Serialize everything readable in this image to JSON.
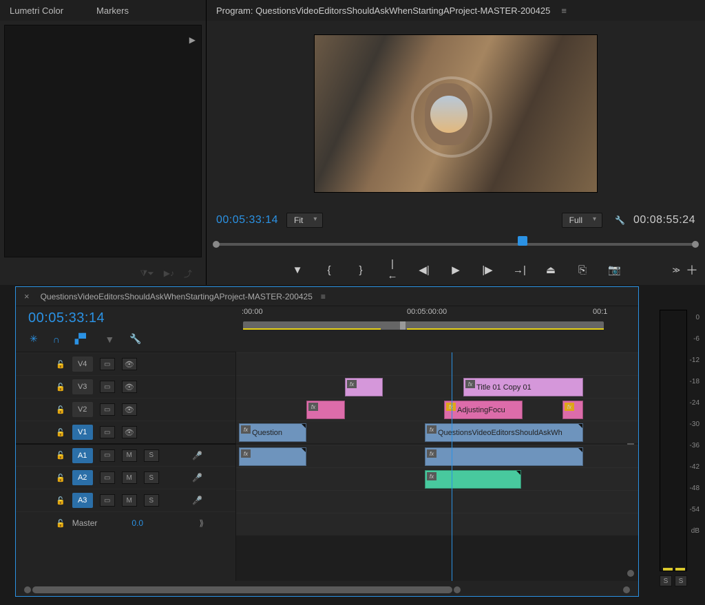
{
  "leftPanel": {
    "tabs": [
      "Lumetri Color",
      "Markers"
    ]
  },
  "program": {
    "title": "Program: QuestionsVideoEditorsShouldAskWhenStartingAProject-MASTER-200425",
    "currentTime": "00:05:33:14",
    "duration": "00:08:55:24",
    "zoom": "Fit",
    "resolution": "Full"
  },
  "timeline": {
    "title": "QuestionsVideoEditorsShouldAskWhenStartingAProject-MASTER-200425",
    "currentTime": "00:05:33:14",
    "ruler": {
      "t0": ":00:00",
      "t1": "00:05:00:00",
      "t2": "00:1"
    },
    "tracks": {
      "video": [
        {
          "id": "V4",
          "active": false
        },
        {
          "id": "V3",
          "active": false
        },
        {
          "id": "V2",
          "active": false
        },
        {
          "id": "V1",
          "active": true
        }
      ],
      "audio": [
        {
          "id": "A1",
          "active": true
        },
        {
          "id": "A2",
          "active": true
        },
        {
          "id": "A3",
          "active": true
        }
      ],
      "master": {
        "label": "Master",
        "value": "0.0"
      }
    },
    "clips": {
      "v3_title": "Title 01 Copy 01",
      "v2_adjust": "AdjustingFocu",
      "v1_question": "Question",
      "v1_main": "QuestionsVideoEditorsShouldAskWh"
    }
  },
  "meters": {
    "scale": [
      "0",
      "-6",
      "-12",
      "-18",
      "-24",
      "-30",
      "-36",
      "-42",
      "-48",
      "-54",
      "dB"
    ],
    "solo": "S"
  }
}
